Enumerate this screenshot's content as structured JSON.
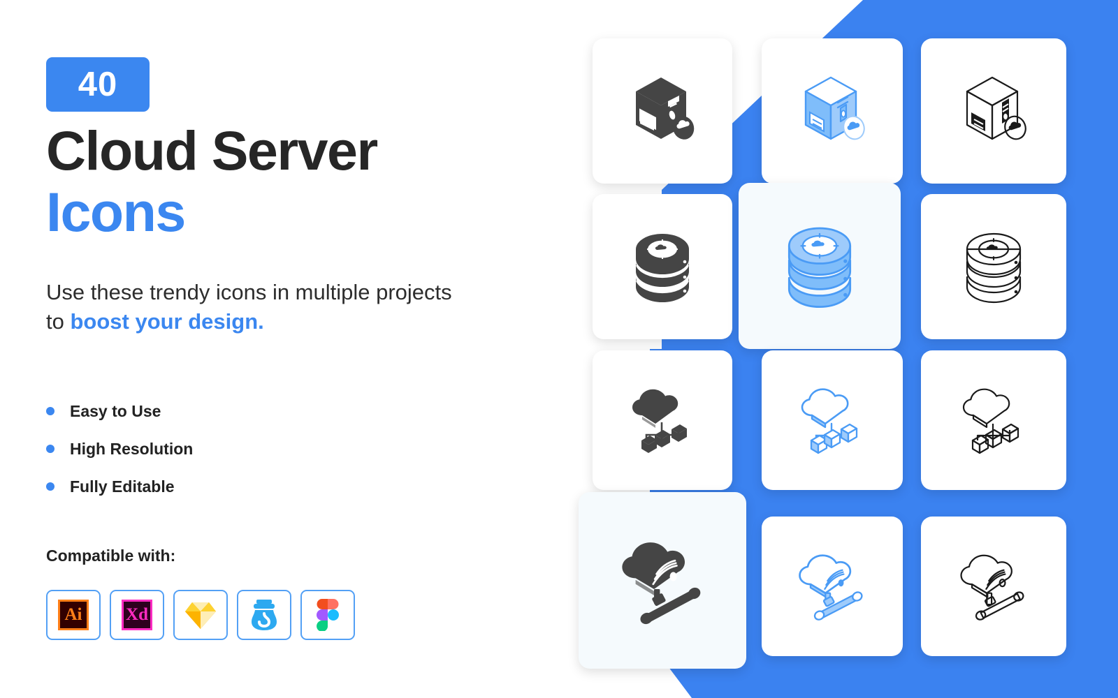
{
  "theme": {
    "accent_blue": "#3b87f0",
    "icon_blue": "#4a9bf5",
    "icon_blue_light": "#9ecbfb",
    "icon_dark": "#454545",
    "icon_outline": "#1a1a1a",
    "card_white": "#ffffff",
    "card_featured": "#f5fafd",
    "text_dark": "#262626",
    "page_bg": "#ffffff"
  },
  "left_panel": {
    "count_badge": "40",
    "title_line1": "Cloud Server",
    "title_line2": "Icons",
    "subtitle_prefix": "Use these trendy icons in multiple projects to ",
    "subtitle_accent": "boost your design.",
    "features": [
      {
        "label": "Easy to Use"
      },
      {
        "label": "High Resolution"
      },
      {
        "label": "Fully Editable"
      }
    ],
    "compat_heading": "Compatible with:",
    "compat_apps": [
      {
        "name": "adobe-illustrator",
        "label": "Ai"
      },
      {
        "name": "adobe-xd",
        "label": "Xd"
      },
      {
        "name": "sketch",
        "label": ""
      },
      {
        "name": "iconjar",
        "label": ""
      },
      {
        "name": "figma",
        "label": ""
      }
    ]
  },
  "icon_grid": {
    "rows": 4,
    "columns": 3,
    "styles": [
      "glyph-filled",
      "flat-color",
      "line-outline"
    ],
    "cards": [
      {
        "name": "server-cloud-glyph",
        "style": "glyph-filled",
        "icon": "server-tower-cloud",
        "featured": false
      },
      {
        "name": "server-cloud-flat",
        "style": "flat-color",
        "icon": "server-tower-cloud",
        "featured": false
      },
      {
        "name": "server-cloud-line",
        "style": "line-outline",
        "icon": "server-tower-cloud",
        "featured": false
      },
      {
        "name": "database-cloud-glyph",
        "style": "glyph-filled",
        "icon": "database-stack-cloud",
        "featured": false
      },
      {
        "name": "database-cloud-flat",
        "style": "flat-color",
        "icon": "database-stack-cloud",
        "featured": true
      },
      {
        "name": "database-cloud-line",
        "style": "line-outline",
        "icon": "database-stack-cloud",
        "featured": false
      },
      {
        "name": "cloud-network-glyph",
        "style": "glyph-filled",
        "icon": "cloud-network-nodes",
        "featured": false
      },
      {
        "name": "cloud-network-flat",
        "style": "flat-color",
        "icon": "cloud-network-nodes",
        "featured": false
      },
      {
        "name": "cloud-network-line",
        "style": "line-outline",
        "icon": "cloud-network-nodes",
        "featured": false
      },
      {
        "name": "cloud-connection-glyph",
        "style": "glyph-filled",
        "icon": "cloud-signal-connector",
        "featured": true
      },
      {
        "name": "cloud-connection-flat",
        "style": "flat-color",
        "icon": "cloud-signal-connector",
        "featured": false
      },
      {
        "name": "cloud-connection-line",
        "style": "line-outline",
        "icon": "cloud-signal-connector",
        "featured": false
      }
    ]
  }
}
